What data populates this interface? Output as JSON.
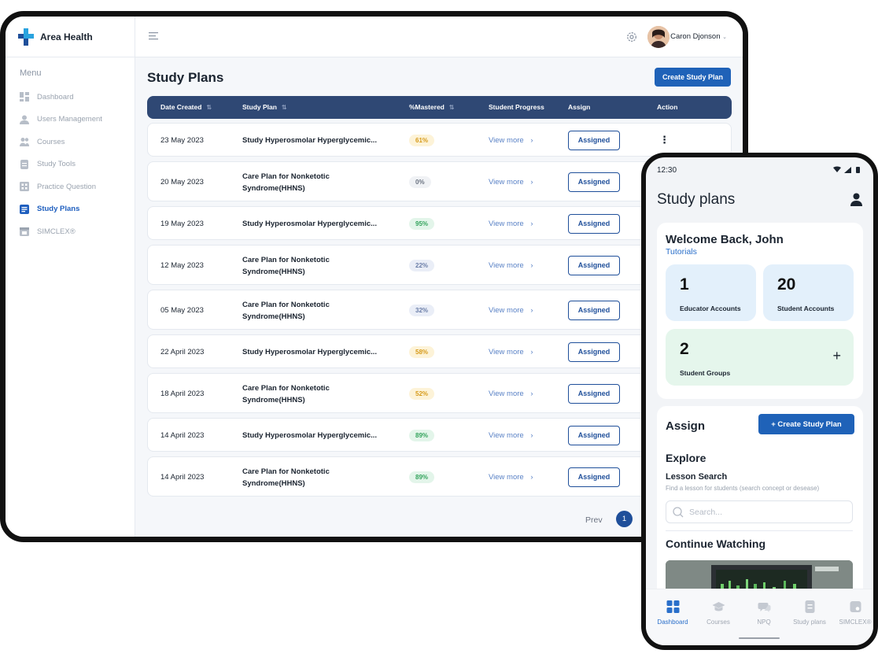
{
  "tablet": {
    "brand": "Area Health",
    "menu_title": "Menu",
    "nav": [
      {
        "label": "Dashboard"
      },
      {
        "label": "Users Management"
      },
      {
        "label": "Courses"
      },
      {
        "label": "Study Tools"
      },
      {
        "label": "Practice Question"
      },
      {
        "label": "Study Plans",
        "active": true
      },
      {
        "label": "SIMCLEX®"
      }
    ],
    "user_name": "Caron Djonson",
    "page_title": "Study Plans",
    "create_button": "Create Study Plan",
    "columns": {
      "date": "Date Created",
      "plan": "Study Plan",
      "mastered": "%Mastered",
      "progress": "Student Progress",
      "assign": "Assign",
      "action": "Action"
    },
    "sort_icon": "⇅",
    "rows": [
      {
        "date": "23 May 2023",
        "plan": "Study Hyperosmolar Hyperglycemic...",
        "mastered": "61%",
        "color": "y",
        "view": "View more",
        "assign": "Assigned"
      },
      {
        "date": "20 May 2023",
        "plan": "Care Plan for Nonketotic Syndrome(HHNS)",
        "mastered": "0%",
        "color": "n",
        "view": "View more",
        "assign": "Assigned"
      },
      {
        "date": "19 May 2023",
        "plan": "Study Hyperosmolar Hyperglycemic...",
        "mastered": "95%",
        "color": "g",
        "view": "View more",
        "assign": "Assigned"
      },
      {
        "date": "12 May 2023",
        "plan": "Care Plan for Nonketotic Syndrome(HHNS)",
        "mastered": "22%",
        "color": "b",
        "view": "View more",
        "assign": "Assigned"
      },
      {
        "date": "05 May 2023",
        "plan": "Care Plan for Nonketotic Syndrome(HHNS)",
        "mastered": "32%",
        "color": "b",
        "view": "View more",
        "assign": "Assigned"
      },
      {
        "date": "22 April 2023",
        "plan": "Study Hyperosmolar Hyperglycemic...",
        "mastered": "58%",
        "color": "y",
        "view": "View more",
        "assign": "Assigned"
      },
      {
        "date": "18 April 2023",
        "plan": "Care Plan for Nonketotic Syndrome(HHNS)",
        "mastered": "52%",
        "color": "y",
        "view": "View more",
        "assign": "Assigned"
      },
      {
        "date": "14 April 2023",
        "plan": "Study Hyperosmolar Hyperglycemic...",
        "mastered": "89%",
        "color": "g",
        "view": "View more",
        "assign": "Assigned"
      },
      {
        "date": "14 April 2023",
        "plan": "Care Plan for Nonketotic Syndrome(HHNS)",
        "mastered": "89%",
        "color": "g",
        "view": "View more",
        "assign": "Assigned"
      }
    ],
    "pagination": {
      "prev": "Prev",
      "current": "1"
    }
  },
  "phone": {
    "time": "12:30",
    "title": "Study plans",
    "welcome": "Welcome Back, John",
    "tutorials": "Tutorials",
    "stats": {
      "educators": {
        "value": "1",
        "label": "Educator Accounts"
      },
      "students": {
        "value": "20",
        "label": "Student Accounts"
      },
      "groups": {
        "value": "2",
        "label": "Student Groups"
      }
    },
    "assign_heading": "Assign",
    "create_button": "+ Create Study Plan",
    "explore": "Explore",
    "lesson_search": "Lesson Search",
    "lesson_desc": "Find a lesson for students (search concept or desease)",
    "search_placeholder": "Search...",
    "continue_watching": "Continue Watching",
    "bottom_nav": [
      {
        "label": "Dashboard",
        "active": true
      },
      {
        "label": "Courses"
      },
      {
        "label": "NPQ"
      },
      {
        "label": "Study plans"
      },
      {
        "label": "SIMCLEX®"
      }
    ]
  },
  "colors": {
    "primary": "#1f62b8",
    "header": "#2f4874",
    "active_nav": "#1f5fbf"
  }
}
